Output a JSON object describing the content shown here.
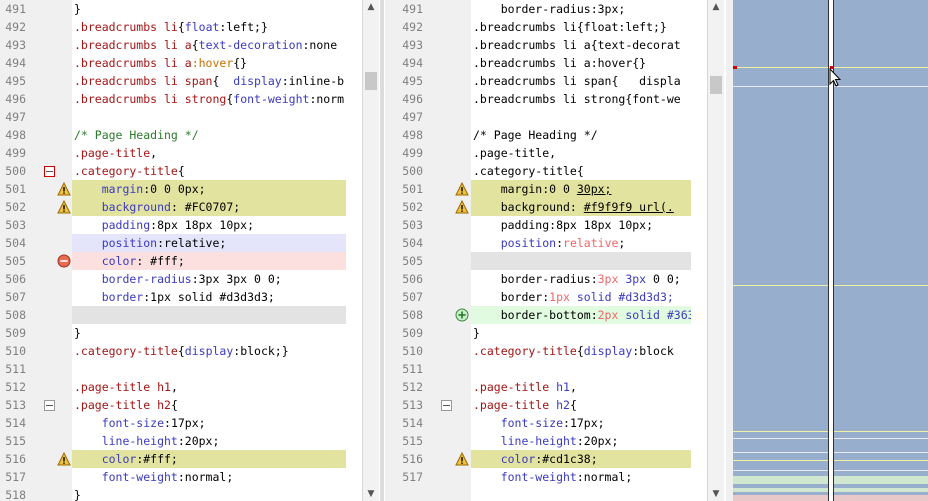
{
  "left": {
    "rows": [
      {
        "ln": "491",
        "mark": "",
        "fold": "",
        "hl": "",
        "tokens": [
          [
            "}",
            "punct"
          ]
        ]
      },
      {
        "ln": "492",
        "mark": "",
        "fold": "",
        "hl": "",
        "tokens": [
          [
            ".breadcrumbs li",
            "sel"
          ],
          [
            "{",
            "punct"
          ],
          [
            "float",
            "prop"
          ],
          [
            ":left;}",
            "val"
          ]
        ]
      },
      {
        "ln": "493",
        "mark": "",
        "fold": "",
        "hl": "",
        "tokens": [
          [
            ".breadcrumbs li a",
            "sel"
          ],
          [
            "{",
            "punct"
          ],
          [
            "text-decoration",
            "prop"
          ],
          [
            ":none",
            "val"
          ]
        ]
      },
      {
        "ln": "494",
        "mark": "",
        "fold": "",
        "hl": "",
        "tokens": [
          [
            ".breadcrumbs li a",
            "sel"
          ],
          [
            ":hover",
            "pseudo"
          ],
          [
            "{}",
            "punct"
          ]
        ]
      },
      {
        "ln": "495",
        "mark": "",
        "fold": "",
        "hl": "",
        "tokens": [
          [
            ".breadcrumbs li span",
            "sel"
          ],
          [
            "{  ",
            "punct"
          ],
          [
            "display",
            "prop"
          ],
          [
            ":inline-b",
            "val"
          ]
        ]
      },
      {
        "ln": "496",
        "mark": "",
        "fold": "",
        "hl": "",
        "tokens": [
          [
            ".breadcrumbs li strong",
            "sel"
          ],
          [
            "{",
            "punct"
          ],
          [
            "font-weight",
            "prop"
          ],
          [
            ":norm",
            "val"
          ]
        ]
      },
      {
        "ln": "497",
        "mark": "",
        "fold": "",
        "hl": "",
        "tokens": []
      },
      {
        "ln": "498",
        "mark": "",
        "fold": "",
        "hl": "",
        "tokens": [
          [
            "/* Page Heading */",
            "comment"
          ]
        ]
      },
      {
        "ln": "499",
        "mark": "",
        "fold": "",
        "hl": "",
        "tokens": [
          [
            ".page-title",
            "sel"
          ],
          [
            ",",
            "punct"
          ]
        ]
      },
      {
        "ln": "500",
        "mark": "",
        "fold": "minus-red",
        "hl": "",
        "tokens": [
          [
            ".category-title",
            "sel"
          ],
          [
            "{",
            "punct"
          ]
        ]
      },
      {
        "ln": "501",
        "mark": "warn",
        "fold": "",
        "hl": "yellow",
        "tokens": [
          [
            "    margin",
            "prop"
          ],
          [
            ":0 0 0px;",
            "val"
          ]
        ]
      },
      {
        "ln": "502",
        "mark": "warn",
        "fold": "",
        "hl": "yellow",
        "tokens": [
          [
            "    background",
            "prop"
          ],
          [
            ": #FC0707;",
            "val"
          ]
        ]
      },
      {
        "ln": "503",
        "mark": "",
        "fold": "",
        "hl": "",
        "tokens": [
          [
            "    padding",
            "prop"
          ],
          [
            ":8px 18px 10px;",
            "val"
          ]
        ]
      },
      {
        "ln": "504",
        "mark": "",
        "fold": "",
        "hl": "blue",
        "tokens": [
          [
            "    position",
            "prop"
          ],
          [
            ":relative;",
            "val"
          ]
        ]
      },
      {
        "ln": "505",
        "mark": "minus",
        "fold": "",
        "hl": "pink",
        "tokens": [
          [
            "    color",
            "prop"
          ],
          [
            ": #fff;",
            "val"
          ]
        ]
      },
      {
        "ln": "506",
        "mark": "",
        "fold": "",
        "hl": "",
        "tokens": [
          [
            "    border-radius",
            "prop"
          ],
          [
            ":3px 3px 0 0;",
            "val"
          ]
        ]
      },
      {
        "ln": "507",
        "mark": "",
        "fold": "",
        "hl": "",
        "tokens": [
          [
            "    border",
            "prop"
          ],
          [
            ":1px solid #d3d3d3;",
            "val"
          ]
        ]
      },
      {
        "ln": "508",
        "mark": "",
        "fold": "",
        "hl": "gray",
        "tokens": []
      },
      {
        "ln": "509",
        "mark": "",
        "fold": "",
        "hl": "",
        "tokens": [
          [
            "}",
            "punct"
          ]
        ]
      },
      {
        "ln": "510",
        "mark": "",
        "fold": "",
        "hl": "",
        "tokens": [
          [
            ".category-title",
            "sel"
          ],
          [
            "{",
            "punct"
          ],
          [
            "display",
            "prop"
          ],
          [
            ":block;}",
            "val"
          ]
        ]
      },
      {
        "ln": "511",
        "mark": "",
        "fold": "",
        "hl": "",
        "tokens": []
      },
      {
        "ln": "512",
        "mark": "",
        "fold": "",
        "hl": "",
        "tokens": [
          [
            ".page-title h1",
            "sel"
          ],
          [
            ",",
            "punct"
          ]
        ]
      },
      {
        "ln": "513",
        "mark": "",
        "fold": "minus",
        "hl": "",
        "tokens": [
          [
            ".page-title h2",
            "sel"
          ],
          [
            "{",
            "punct"
          ]
        ]
      },
      {
        "ln": "514",
        "mark": "",
        "fold": "",
        "hl": "",
        "tokens": [
          [
            "    font-size",
            "prop"
          ],
          [
            ":17px;",
            "val"
          ]
        ]
      },
      {
        "ln": "515",
        "mark": "",
        "fold": "",
        "hl": "",
        "tokens": [
          [
            "    line-height",
            "prop"
          ],
          [
            ":20px;",
            "val"
          ]
        ]
      },
      {
        "ln": "516",
        "mark": "warn",
        "fold": "",
        "hl": "yellow",
        "tokens": [
          [
            "    color",
            "prop"
          ],
          [
            ":#fff;",
            "val"
          ]
        ]
      },
      {
        "ln": "517",
        "mark": "",
        "fold": "",
        "hl": "",
        "tokens": [
          [
            "    font-weight",
            "prop"
          ],
          [
            ":normal;",
            "val"
          ]
        ]
      },
      {
        "ln": "518",
        "mark": "",
        "fold": "",
        "hl": "",
        "tokens": [
          [
            "}",
            "punct"
          ]
        ]
      }
    ]
  },
  "right": {
    "rows": [
      {
        "ln": "491",
        "mark": "",
        "fold": "",
        "hl": "",
        "tokens": [
          [
            "    border-radius:3px;",
            "val"
          ]
        ]
      },
      {
        "ln": "492",
        "mark": "",
        "fold": "",
        "hl": "",
        "tokens": [
          [
            ".breadcrumbs li{float:left;}",
            "val"
          ]
        ]
      },
      {
        "ln": "493",
        "mark": "",
        "fold": "",
        "hl": "",
        "tokens": [
          [
            ".breadcrumbs li a{text-decorat",
            "val"
          ]
        ]
      },
      {
        "ln": "494",
        "mark": "",
        "fold": "",
        "hl": "",
        "tokens": [
          [
            ".breadcrumbs li a:hover{}",
            "val"
          ]
        ]
      },
      {
        "ln": "495",
        "mark": "",
        "fold": "",
        "hl": "",
        "tokens": [
          [
            ".breadcrumbs li span{   displa",
            "val"
          ]
        ]
      },
      {
        "ln": "496",
        "mark": "",
        "fold": "",
        "hl": "",
        "tokens": [
          [
            ".breadcrumbs li strong{font-we",
            "val"
          ]
        ]
      },
      {
        "ln": "497",
        "mark": "",
        "fold": "",
        "hl": "",
        "tokens": []
      },
      {
        "ln": "498",
        "mark": "",
        "fold": "",
        "hl": "",
        "tokens": [
          [
            "/* Page Heading */",
            "val"
          ]
        ]
      },
      {
        "ln": "499",
        "mark": "",
        "fold": "",
        "hl": "",
        "tokens": [
          [
            ".page-title,",
            "val"
          ]
        ]
      },
      {
        "ln": "500",
        "mark": "",
        "fold": "",
        "hl": "",
        "tokens": [
          [
            ".category-title{",
            "val"
          ]
        ]
      },
      {
        "ln": "501",
        "mark": "warn",
        "fold": "",
        "hl": "yellow",
        "tokens": [
          [
            "    margin:0 0 ",
            "val"
          ],
          [
            "30px;",
            "uval"
          ]
        ]
      },
      {
        "ln": "502",
        "mark": "warn",
        "fold": "",
        "hl": "yellow",
        "tokens": [
          [
            "    background: ",
            "val"
          ],
          [
            "#f9f9f9 url(.",
            "uval"
          ]
        ]
      },
      {
        "ln": "503",
        "mark": "",
        "fold": "",
        "hl": "",
        "tokens": [
          [
            "    padding:8px 18px 10px;",
            "val"
          ]
        ]
      },
      {
        "ln": "504",
        "mark": "",
        "fold": "",
        "hl": "",
        "tokens": [
          [
            "    position",
            "prop"
          ],
          [
            ":",
            "punct"
          ],
          [
            "relative",
            "num"
          ],
          [
            ";",
            "punct"
          ]
        ]
      },
      {
        "ln": "505",
        "mark": "",
        "fold": "",
        "hl": "gray",
        "tokens": []
      },
      {
        "ln": "506",
        "mark": "",
        "fold": "",
        "hl": "",
        "tokens": [
          [
            "    border-radius:",
            "val"
          ],
          [
            "3px",
            "num"
          ],
          [
            " 3px ",
            "prop"
          ],
          [
            "0 0;",
            "val"
          ]
        ]
      },
      {
        "ln": "507",
        "mark": "",
        "fold": "",
        "hl": "",
        "tokens": [
          [
            "    border:",
            "val"
          ],
          [
            "1px",
            "num"
          ],
          [
            " solid ",
            "prop"
          ],
          [
            "#d3d3d3;",
            "prop"
          ]
        ]
      },
      {
        "ln": "508",
        "mark": "plus",
        "fold": "",
        "hl": "green",
        "tokens": [
          [
            "    border-bottom:",
            "val"
          ],
          [
            "2px",
            "num"
          ],
          [
            " solid ",
            "prop"
          ],
          [
            "#363",
            "prop"
          ]
        ]
      },
      {
        "ln": "509",
        "mark": "",
        "fold": "",
        "hl": "",
        "tokens": [
          [
            "}",
            "val"
          ]
        ]
      },
      {
        "ln": "510",
        "mark": "",
        "fold": "",
        "hl": "",
        "tokens": [
          [
            ".category-title",
            "sel"
          ],
          [
            "{",
            "punct"
          ],
          [
            "display",
            "prop"
          ],
          [
            ":block",
            "val"
          ]
        ]
      },
      {
        "ln": "511",
        "mark": "",
        "fold": "",
        "hl": "",
        "tokens": []
      },
      {
        "ln": "512",
        "mark": "",
        "fold": "",
        "hl": "",
        "tokens": [
          [
            ".page-title",
            "sel"
          ],
          [
            " h1",
            "prop"
          ],
          [
            ",",
            "punct"
          ]
        ]
      },
      {
        "ln": "513",
        "mark": "",
        "fold": "minus",
        "hl": "",
        "tokens": [
          [
            ".page-title",
            "sel"
          ],
          [
            " h2",
            "prop"
          ],
          [
            "{",
            "punct"
          ]
        ]
      },
      {
        "ln": "514",
        "mark": "",
        "fold": "",
        "hl": "",
        "tokens": [
          [
            "    font-size",
            "prop"
          ],
          [
            ":17px;",
            "val"
          ]
        ]
      },
      {
        "ln": "515",
        "mark": "",
        "fold": "",
        "hl": "",
        "tokens": [
          [
            "    line-height",
            "prop"
          ],
          [
            ":20px;",
            "val"
          ]
        ]
      },
      {
        "ln": "516",
        "mark": "warn",
        "fold": "",
        "hl": "yellow",
        "tokens": [
          [
            "    color",
            "prop"
          ],
          [
            ":#cd1c38;",
            "val"
          ]
        ]
      },
      {
        "ln": "517",
        "mark": "",
        "fold": "",
        "hl": "",
        "tokens": [
          [
            "    font-weight",
            "prop"
          ],
          [
            ":normal;",
            "val"
          ]
        ]
      }
    ]
  },
  "colors": {
    "selector": "#a31515",
    "property": "#3a3ac0",
    "value": "#000000",
    "comment": "#2b7a2b",
    "highlight_changed": "#e3e3a0",
    "highlight_added": "#e0fbe0",
    "highlight_removed": "#fce0e0",
    "overview_bg": "#98aecd"
  }
}
